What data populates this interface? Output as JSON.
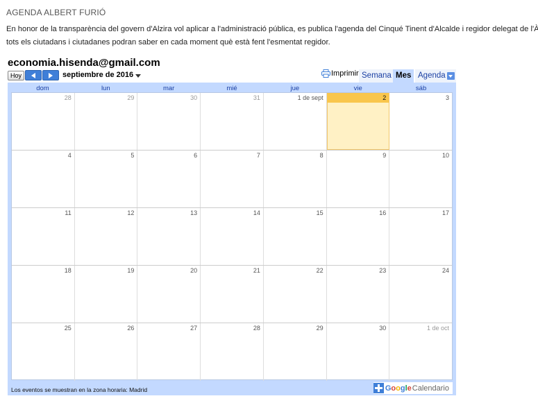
{
  "header": {
    "title": "AGENDA ALBERT FURIÓ",
    "intro_line1": "En honor de la transparència del govern d'Alzira vol aplicar a l'administració pública, es publica l'agenda del Cinqué Tinent d'Alcalde i regidor delegat de l'Àrea d'Ec",
    "intro_line2": "tots els ciutadans i ciutadanes podran saber en cada moment què està fent l'esmentat regidor."
  },
  "calendar": {
    "owner": "economia.hisenda@gmail.com",
    "today_label": "Hoy",
    "month_label": "septiembre de 2016",
    "print_label": "Imprimir",
    "tabs": {
      "week": "Semana",
      "month": "Mes",
      "agenda": "Agenda"
    },
    "weekdays": [
      "dom",
      "lun",
      "mar",
      "mié",
      "jue",
      "vie",
      "sáb"
    ],
    "weeks": [
      [
        {
          "label": "28",
          "other": true
        },
        {
          "label": "29",
          "other": true
        },
        {
          "label": "30",
          "other": true
        },
        {
          "label": "31",
          "other": true
        },
        {
          "label": "1 de sept",
          "other": false
        },
        {
          "label": "2",
          "other": false,
          "today": true
        },
        {
          "label": "3",
          "other": false
        }
      ],
      [
        {
          "label": "4"
        },
        {
          "label": "5"
        },
        {
          "label": "6"
        },
        {
          "label": "7"
        },
        {
          "label": "8"
        },
        {
          "label": "9"
        },
        {
          "label": "10"
        }
      ],
      [
        {
          "label": "11"
        },
        {
          "label": "12"
        },
        {
          "label": "13"
        },
        {
          "label": "14"
        },
        {
          "label": "15"
        },
        {
          "label": "16"
        },
        {
          "label": "17"
        }
      ],
      [
        {
          "label": "18"
        },
        {
          "label": "19"
        },
        {
          "label": "20"
        },
        {
          "label": "21"
        },
        {
          "label": "22"
        },
        {
          "label": "23"
        },
        {
          "label": "24"
        }
      ],
      [
        {
          "label": "25"
        },
        {
          "label": "26"
        },
        {
          "label": "27"
        },
        {
          "label": "28"
        },
        {
          "label": "29"
        },
        {
          "label": "30"
        },
        {
          "label": "1 de oct",
          "other": true
        }
      ]
    ],
    "timezone_note": "Los eventos se muestran en la zona horaria: Madrid",
    "badge": {
      "google": "Google",
      "calendar": "Calendario"
    },
    "colors": {
      "header_bg": "#c3d9ff",
      "today_bg": "#fff1c5",
      "today_bar": "#f9c64c",
      "nav_button": "#3f7fd8"
    }
  }
}
